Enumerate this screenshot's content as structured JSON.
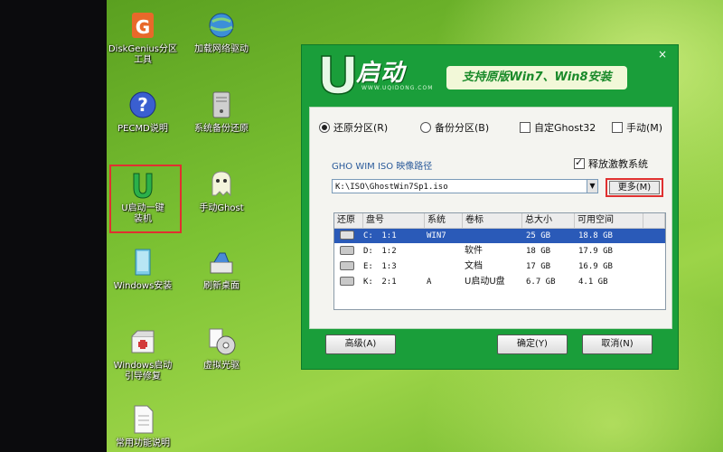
{
  "desktop": {
    "icons": [
      {
        "name": "diskgenius-icon",
        "label": "DiskGenius分区\n工具"
      },
      {
        "name": "network-icon",
        "label": "加载网络驱动"
      },
      {
        "name": "help-icon",
        "label": "PECMD说明"
      },
      {
        "name": "system-icon",
        "label": "系统备份还原"
      },
      {
        "name": "u-install-icon",
        "label": "U启动一键\n装机"
      },
      {
        "name": "ghost-icon",
        "label": "手动Ghost"
      },
      {
        "name": "windows-install-icon",
        "label": "Windows安装"
      },
      {
        "name": "refresh-icon",
        "label": "刷新桌面"
      },
      {
        "name": "boot-repair-icon",
        "label": "Windows启动\n引导修复"
      },
      {
        "name": "virtual-cd-icon",
        "label": "虚拟光驱"
      },
      {
        "name": "doc-icon",
        "label": "常用功能说明"
      }
    ]
  },
  "dialog": {
    "logo_text": "启动",
    "logo_sub": "WWW.UQIDONG.COM",
    "slogan": "支持原版Win7、Win8安装",
    "close_label": "×",
    "modes": [
      {
        "label": "还原分区(R)",
        "selected": true
      },
      {
        "label": "备份分区(B)",
        "selected": false
      },
      {
        "label": "自定Ghost32",
        "checked": false
      },
      {
        "label": "手动(M)",
        "checked": false
      }
    ],
    "path_label": "GHO WIM ISO 映像路径",
    "restore_checkbox": {
      "label": "释放激教系统",
      "checked": true
    },
    "path_value": "K:\\ISO\\GhostWin7Sp1.iso",
    "more_button": "更多(M)",
    "table": {
      "headers": [
        "还原",
        "盘号",
        "系统",
        "卷标",
        "总大小",
        "可用空间",
        ""
      ],
      "rows": [
        {
          "drive": "C:",
          "disk": "1:1",
          "system": "WIN7",
          "volume": "",
          "total": "25 GB",
          "free": "18.8 GB",
          "selected": true
        },
        {
          "drive": "D:",
          "disk": "1:2",
          "system": "",
          "volume": "软件",
          "total": "18 GB",
          "free": "17.9 GB",
          "selected": false
        },
        {
          "drive": "E:",
          "disk": "1:3",
          "system": "",
          "volume": "文档",
          "total": "17 GB",
          "free": "16.9 GB",
          "selected": false
        },
        {
          "drive": "K:",
          "disk": "2:1",
          "system": "A",
          "volume": "U启动U盘",
          "total": "6.7 GB",
          "free": "4.1 GB",
          "selected": false
        }
      ]
    },
    "footer": {
      "advanced": "高级(A)",
      "ok": "确定(Y)",
      "cancel": "取消(N)"
    }
  },
  "colors": {
    "dialog_green": "#1a9e3a",
    "selection_blue": "#2a5ab8",
    "highlight_red": "#e03030"
  }
}
